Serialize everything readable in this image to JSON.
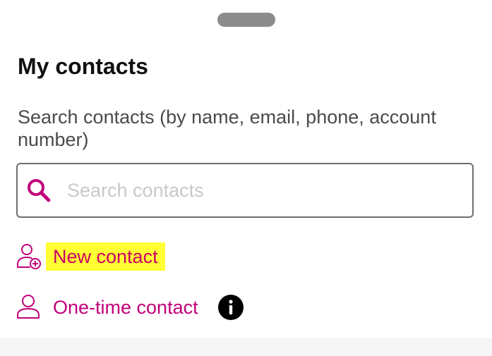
{
  "sheet": {
    "title": "My contacts"
  },
  "search": {
    "help_text": "Search contacts (by name, email, phone, account number)",
    "placeholder": "Search contacts",
    "value": ""
  },
  "actions": {
    "new_contact_label": "New contact",
    "one_time_contact_label": "One-time contact"
  },
  "icons": {
    "search": "search-icon",
    "new_contact": "add-person-icon",
    "one_time_contact": "person-icon",
    "info": "info-icon"
  },
  "colors": {
    "accent": "#c2007a",
    "highlight": "#ffff33",
    "handle": "#8c8c8c"
  }
}
